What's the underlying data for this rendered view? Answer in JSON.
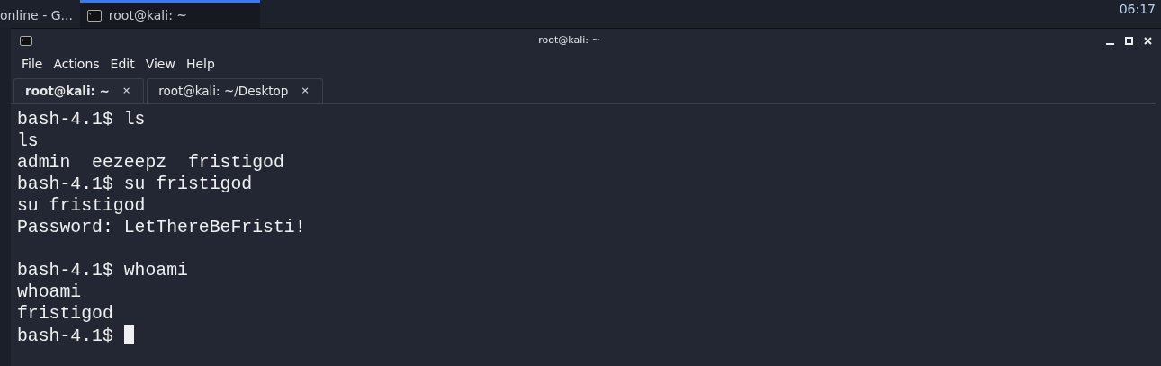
{
  "taskbar": {
    "items": [
      {
        "label": "online - G...",
        "selected": false
      },
      {
        "label": "root@kali: ~",
        "selected": true
      }
    ],
    "clock": "06:17"
  },
  "window": {
    "title": "root@kali: ~"
  },
  "menu": [
    "File",
    "Actions",
    "Edit",
    "View",
    "Help"
  ],
  "tabs": [
    {
      "label": "root@kali: ~",
      "close": "×",
      "selected": true
    },
    {
      "label": "root@kali: ~/Desktop",
      "close": "×",
      "selected": false
    }
  ],
  "terminal": {
    "blocks": [
      [
        {
          "text": "bash-4.1$ ls",
          "cursor": false
        },
        {
          "text": "ls",
          "cursor": false
        },
        {
          "text": "admin  eezeepz  fristigod",
          "cursor": false
        },
        {
          "text": "bash-4.1$ su fristigod",
          "cursor": false
        },
        {
          "text": "su fristigod",
          "cursor": false
        },
        {
          "text": "Password: LetThereBeFristi!",
          "cursor": false
        }
      ],
      [
        {
          "text": "bash-4.1$ whoami",
          "cursor": false
        },
        {
          "text": "whoami",
          "cursor": false
        },
        {
          "text": "fristigod",
          "cursor": false
        },
        {
          "text": "bash-4.1$",
          "cursor": true
        }
      ]
    ]
  }
}
